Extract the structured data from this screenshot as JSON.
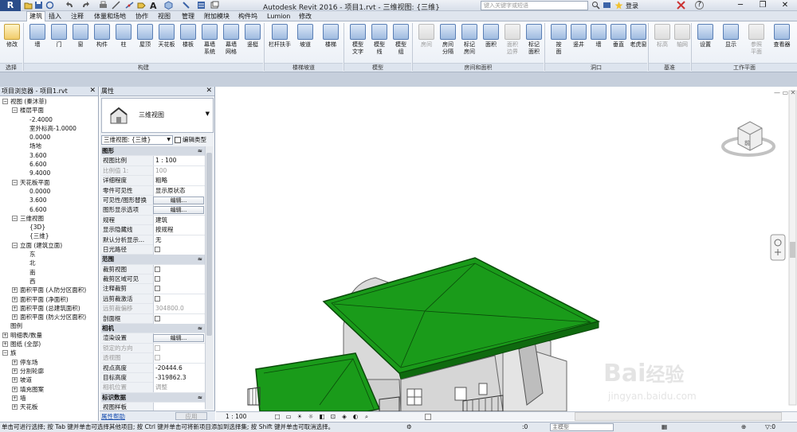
{
  "app": {
    "title": "Autodesk Revit 2016 -   项目1.rvt - 三维视图: {三维}",
    "logo_letter": "R",
    "search_placeholder": "键入关键字或短语",
    "login": "登录",
    "help": "?"
  },
  "tabs": [
    "建筑",
    "插入",
    "注释",
    "体量和场地",
    "协作",
    "视图",
    "管理",
    "附加模块",
    "构件坞",
    "Lumion",
    "修改"
  ],
  "ribbon": {
    "modify": "修改",
    "select": "选择",
    "panel_build": "构建",
    "panel_stairs": "楼梯坡道",
    "panel_model": "模型",
    "panel_room": "房间和面积",
    "panel_opening": "洞口",
    "panel_datum": "基准",
    "panel_workplane": "工作平面",
    "build_buttons": [
      "墙",
      "门",
      "窗",
      "构件",
      "柱",
      "屋顶",
      "天花板",
      "楼板",
      "幕墙\n系统",
      "幕墙\n网格",
      "竖梃"
    ],
    "stairs_buttons": [
      "栏杆扶手",
      "坡道",
      "楼梯"
    ],
    "model_buttons": [
      "模型\n文字",
      "模型\n线",
      "模型\n组"
    ],
    "room_buttons": [
      "房间",
      "房间\n分隔",
      "标记\n房间",
      "面积",
      "面积\n边界",
      "标记\n面积"
    ],
    "opening_buttons": [
      "按\n面",
      "竖井",
      "墙",
      "垂直",
      "老虎窗"
    ],
    "datum_buttons": [
      "标高",
      "轴网"
    ],
    "workplane_buttons": [
      "设置",
      "显示",
      "参照\n平面",
      "查看器"
    ]
  },
  "browser": {
    "title": "项目浏览器 - 项目1.rvt",
    "items": [
      {
        "label": "视图 (秦沐菲)",
        "level": 0,
        "toggle": "-"
      },
      {
        "label": "楼层平面",
        "level": 1,
        "toggle": "-"
      },
      {
        "label": "-2.4000",
        "level": 2,
        "toggle": ""
      },
      {
        "label": "室外标高-1.0000",
        "level": 2,
        "toggle": ""
      },
      {
        "label": "0.0000",
        "level": 2,
        "toggle": ""
      },
      {
        "label": "场地",
        "level": 2,
        "toggle": ""
      },
      {
        "label": "3.600",
        "level": 2,
        "toggle": ""
      },
      {
        "label": "6.600",
        "level": 2,
        "toggle": ""
      },
      {
        "label": "9.4000",
        "level": 2,
        "toggle": ""
      },
      {
        "label": "天花板平面",
        "level": 1,
        "toggle": "-"
      },
      {
        "label": "0.0000",
        "level": 2,
        "toggle": ""
      },
      {
        "label": "3.600",
        "level": 2,
        "toggle": ""
      },
      {
        "label": "6.600",
        "level": 2,
        "toggle": ""
      },
      {
        "label": "三维视图",
        "level": 1,
        "toggle": "-"
      },
      {
        "label": "{3D}",
        "level": 2,
        "toggle": ""
      },
      {
        "label": "{三维}",
        "level": 2,
        "toggle": ""
      },
      {
        "label": "立面 (建筑立面)",
        "level": 1,
        "toggle": "-"
      },
      {
        "label": "东",
        "level": 2,
        "toggle": ""
      },
      {
        "label": "北",
        "level": 2,
        "toggle": ""
      },
      {
        "label": "南",
        "level": 2,
        "toggle": ""
      },
      {
        "label": "西",
        "level": 2,
        "toggle": ""
      },
      {
        "label": "面积平面 (人防分区面积)",
        "level": 1,
        "toggle": "+"
      },
      {
        "label": "面积平面 (净面积)",
        "level": 1,
        "toggle": "+"
      },
      {
        "label": "面积平面 (总建筑面积)",
        "level": 1,
        "toggle": "+"
      },
      {
        "label": "面积平面 (防火分区面积)",
        "level": 1,
        "toggle": "+"
      },
      {
        "label": "图例",
        "level": 0,
        "toggle": ""
      },
      {
        "label": "明细表/数量",
        "level": 0,
        "toggle": "+"
      },
      {
        "label": "图纸 (全部)",
        "level": 0,
        "toggle": "+"
      },
      {
        "label": "族",
        "level": 0,
        "toggle": "-"
      },
      {
        "label": "停车场",
        "level": 1,
        "toggle": "+"
      },
      {
        "label": "分割轮廓",
        "level": 1,
        "toggle": "+"
      },
      {
        "label": "坡道",
        "level": 1,
        "toggle": "+"
      },
      {
        "label": "填充图案",
        "level": 1,
        "toggle": "+"
      },
      {
        "label": "墙",
        "level": 1,
        "toggle": "+"
      },
      {
        "label": "天花板",
        "level": 1,
        "toggle": "+"
      }
    ]
  },
  "properties": {
    "title": "属性",
    "type_name": "三维视图",
    "type_selector": "三维视图: {三维}",
    "edit_type": "编辑类型",
    "help_link": "属性帮助",
    "apply": "应用",
    "rows": [
      {
        "kind": "group",
        "label": "图形"
      },
      {
        "kind": "value",
        "key": "视图比例",
        "value": "1 : 100"
      },
      {
        "kind": "value",
        "key": "比例值 1:",
        "value": "100",
        "readonly": true
      },
      {
        "kind": "value",
        "key": "详细程度",
        "value": "粗略"
      },
      {
        "kind": "value",
        "key": "零件可见性",
        "value": "显示原状态"
      },
      {
        "kind": "button",
        "key": "可见性/图形替换",
        "value": "编辑..."
      },
      {
        "kind": "button",
        "key": "图形显示选项",
        "value": "编辑..."
      },
      {
        "kind": "value",
        "key": "规程",
        "value": "建筑"
      },
      {
        "kind": "value",
        "key": "显示隐藏线",
        "value": "按规程"
      },
      {
        "kind": "value",
        "key": "默认分析显示...",
        "value": "无"
      },
      {
        "kind": "check",
        "key": "日光路径",
        "value": ""
      },
      {
        "kind": "group",
        "label": "范围"
      },
      {
        "kind": "check",
        "key": "裁剪视图",
        "value": ""
      },
      {
        "kind": "check",
        "key": "裁剪区域可见",
        "value": ""
      },
      {
        "kind": "check",
        "key": "注释裁剪",
        "value": ""
      },
      {
        "kind": "check",
        "key": "远剪裁激活",
        "value": ""
      },
      {
        "kind": "value",
        "key": "远剪裁偏移",
        "value": "304800.0",
        "readonly": true
      },
      {
        "kind": "check",
        "key": "剖面框",
        "value": ""
      },
      {
        "kind": "group",
        "label": "相机"
      },
      {
        "kind": "button",
        "key": "渲染设置",
        "value": "编辑..."
      },
      {
        "kind": "check",
        "key": "锁定的方向",
        "value": "",
        "readonly": true
      },
      {
        "kind": "check",
        "key": "透视图",
        "value": "",
        "readonly": true
      },
      {
        "kind": "value",
        "key": "视点高度",
        "value": "-20444.6"
      },
      {
        "kind": "value",
        "key": "目标高度",
        "value": "-319862.3"
      },
      {
        "kind": "value",
        "key": "相机位置",
        "value": "调整",
        "readonly": true
      },
      {
        "kind": "group",
        "label": "标识数据"
      },
      {
        "kind": "value",
        "key": "视图样板",
        "value": ""
      }
    ]
  },
  "viewport": {
    "scale_label": "1 : 100",
    "nav_cube_label": "前",
    "roof_color": "#1a9b1a",
    "wall_color": "#d8d8d8",
    "view_controls": [
      "□",
      "▭",
      "☀",
      "☼",
      "◧",
      "⊡",
      "◈",
      "◐",
      "⌕"
    ]
  },
  "status": {
    "message": "单击可进行选择; 按 Tab 键并单击可选择其他项目; 按 Ctrl 键并单击可将新项目添加到选择集; 按 Shift 键并单击可取消选择。",
    "zoom": ":0",
    "model": "主模型"
  },
  "watermark": {
    "line1": "Bai",
    "line2": "经验",
    "url": "jingyan.baidu.com"
  }
}
